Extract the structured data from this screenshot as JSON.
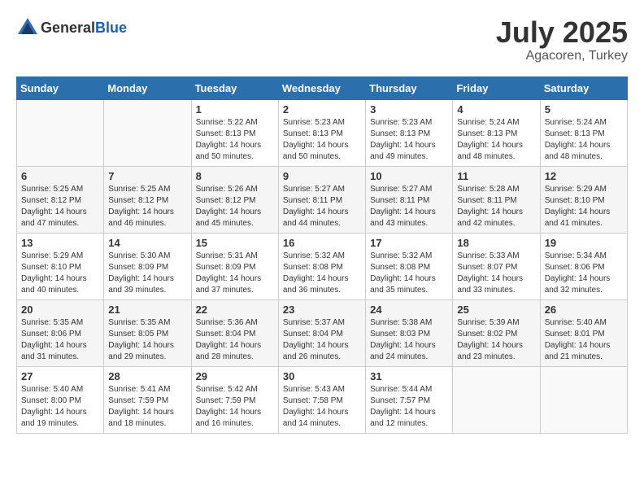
{
  "header": {
    "logo_general": "General",
    "logo_blue": "Blue",
    "month_year": "July 2025",
    "location": "Agacoren, Turkey"
  },
  "calendar": {
    "days_of_week": [
      "Sunday",
      "Monday",
      "Tuesday",
      "Wednesday",
      "Thursday",
      "Friday",
      "Saturday"
    ],
    "weeks": [
      [
        {
          "day": "",
          "sunrise": "",
          "sunset": "",
          "daylight": ""
        },
        {
          "day": "",
          "sunrise": "",
          "sunset": "",
          "daylight": ""
        },
        {
          "day": "1",
          "sunrise": "Sunrise: 5:22 AM",
          "sunset": "Sunset: 8:13 PM",
          "daylight": "Daylight: 14 hours and 50 minutes."
        },
        {
          "day": "2",
          "sunrise": "Sunrise: 5:23 AM",
          "sunset": "Sunset: 8:13 PM",
          "daylight": "Daylight: 14 hours and 50 minutes."
        },
        {
          "day": "3",
          "sunrise": "Sunrise: 5:23 AM",
          "sunset": "Sunset: 8:13 PM",
          "daylight": "Daylight: 14 hours and 49 minutes."
        },
        {
          "day": "4",
          "sunrise": "Sunrise: 5:24 AM",
          "sunset": "Sunset: 8:13 PM",
          "daylight": "Daylight: 14 hours and 48 minutes."
        },
        {
          "day": "5",
          "sunrise": "Sunrise: 5:24 AM",
          "sunset": "Sunset: 8:13 PM",
          "daylight": "Daylight: 14 hours and 48 minutes."
        }
      ],
      [
        {
          "day": "6",
          "sunrise": "Sunrise: 5:25 AM",
          "sunset": "Sunset: 8:12 PM",
          "daylight": "Daylight: 14 hours and 47 minutes."
        },
        {
          "day": "7",
          "sunrise": "Sunrise: 5:25 AM",
          "sunset": "Sunset: 8:12 PM",
          "daylight": "Daylight: 14 hours and 46 minutes."
        },
        {
          "day": "8",
          "sunrise": "Sunrise: 5:26 AM",
          "sunset": "Sunset: 8:12 PM",
          "daylight": "Daylight: 14 hours and 45 minutes."
        },
        {
          "day": "9",
          "sunrise": "Sunrise: 5:27 AM",
          "sunset": "Sunset: 8:11 PM",
          "daylight": "Daylight: 14 hours and 44 minutes."
        },
        {
          "day": "10",
          "sunrise": "Sunrise: 5:27 AM",
          "sunset": "Sunset: 8:11 PM",
          "daylight": "Daylight: 14 hours and 43 minutes."
        },
        {
          "day": "11",
          "sunrise": "Sunrise: 5:28 AM",
          "sunset": "Sunset: 8:11 PM",
          "daylight": "Daylight: 14 hours and 42 minutes."
        },
        {
          "day": "12",
          "sunrise": "Sunrise: 5:29 AM",
          "sunset": "Sunset: 8:10 PM",
          "daylight": "Daylight: 14 hours and 41 minutes."
        }
      ],
      [
        {
          "day": "13",
          "sunrise": "Sunrise: 5:29 AM",
          "sunset": "Sunset: 8:10 PM",
          "daylight": "Daylight: 14 hours and 40 minutes."
        },
        {
          "day": "14",
          "sunrise": "Sunrise: 5:30 AM",
          "sunset": "Sunset: 8:09 PM",
          "daylight": "Daylight: 14 hours and 39 minutes."
        },
        {
          "day": "15",
          "sunrise": "Sunrise: 5:31 AM",
          "sunset": "Sunset: 8:09 PM",
          "daylight": "Daylight: 14 hours and 37 minutes."
        },
        {
          "day": "16",
          "sunrise": "Sunrise: 5:32 AM",
          "sunset": "Sunset: 8:08 PM",
          "daylight": "Daylight: 14 hours and 36 minutes."
        },
        {
          "day": "17",
          "sunrise": "Sunrise: 5:32 AM",
          "sunset": "Sunset: 8:08 PM",
          "daylight": "Daylight: 14 hours and 35 minutes."
        },
        {
          "day": "18",
          "sunrise": "Sunrise: 5:33 AM",
          "sunset": "Sunset: 8:07 PM",
          "daylight": "Daylight: 14 hours and 33 minutes."
        },
        {
          "day": "19",
          "sunrise": "Sunrise: 5:34 AM",
          "sunset": "Sunset: 8:06 PM",
          "daylight": "Daylight: 14 hours and 32 minutes."
        }
      ],
      [
        {
          "day": "20",
          "sunrise": "Sunrise: 5:35 AM",
          "sunset": "Sunset: 8:06 PM",
          "daylight": "Daylight: 14 hours and 31 minutes."
        },
        {
          "day": "21",
          "sunrise": "Sunrise: 5:35 AM",
          "sunset": "Sunset: 8:05 PM",
          "daylight": "Daylight: 14 hours and 29 minutes."
        },
        {
          "day": "22",
          "sunrise": "Sunrise: 5:36 AM",
          "sunset": "Sunset: 8:04 PM",
          "daylight": "Daylight: 14 hours and 28 minutes."
        },
        {
          "day": "23",
          "sunrise": "Sunrise: 5:37 AM",
          "sunset": "Sunset: 8:04 PM",
          "daylight": "Daylight: 14 hours and 26 minutes."
        },
        {
          "day": "24",
          "sunrise": "Sunrise: 5:38 AM",
          "sunset": "Sunset: 8:03 PM",
          "daylight": "Daylight: 14 hours and 24 minutes."
        },
        {
          "day": "25",
          "sunrise": "Sunrise: 5:39 AM",
          "sunset": "Sunset: 8:02 PM",
          "daylight": "Daylight: 14 hours and 23 minutes."
        },
        {
          "day": "26",
          "sunrise": "Sunrise: 5:40 AM",
          "sunset": "Sunset: 8:01 PM",
          "daylight": "Daylight: 14 hours and 21 minutes."
        }
      ],
      [
        {
          "day": "27",
          "sunrise": "Sunrise: 5:40 AM",
          "sunset": "Sunset: 8:00 PM",
          "daylight": "Daylight: 14 hours and 19 minutes."
        },
        {
          "day": "28",
          "sunrise": "Sunrise: 5:41 AM",
          "sunset": "Sunset: 7:59 PM",
          "daylight": "Daylight: 14 hours and 18 minutes."
        },
        {
          "day": "29",
          "sunrise": "Sunrise: 5:42 AM",
          "sunset": "Sunset: 7:59 PM",
          "daylight": "Daylight: 14 hours and 16 minutes."
        },
        {
          "day": "30",
          "sunrise": "Sunrise: 5:43 AM",
          "sunset": "Sunset: 7:58 PM",
          "daylight": "Daylight: 14 hours and 14 minutes."
        },
        {
          "day": "31",
          "sunrise": "Sunrise: 5:44 AM",
          "sunset": "Sunset: 7:57 PM",
          "daylight": "Daylight: 14 hours and 12 minutes."
        },
        {
          "day": "",
          "sunrise": "",
          "sunset": "",
          "daylight": ""
        },
        {
          "day": "",
          "sunrise": "",
          "sunset": "",
          "daylight": ""
        }
      ]
    ]
  }
}
